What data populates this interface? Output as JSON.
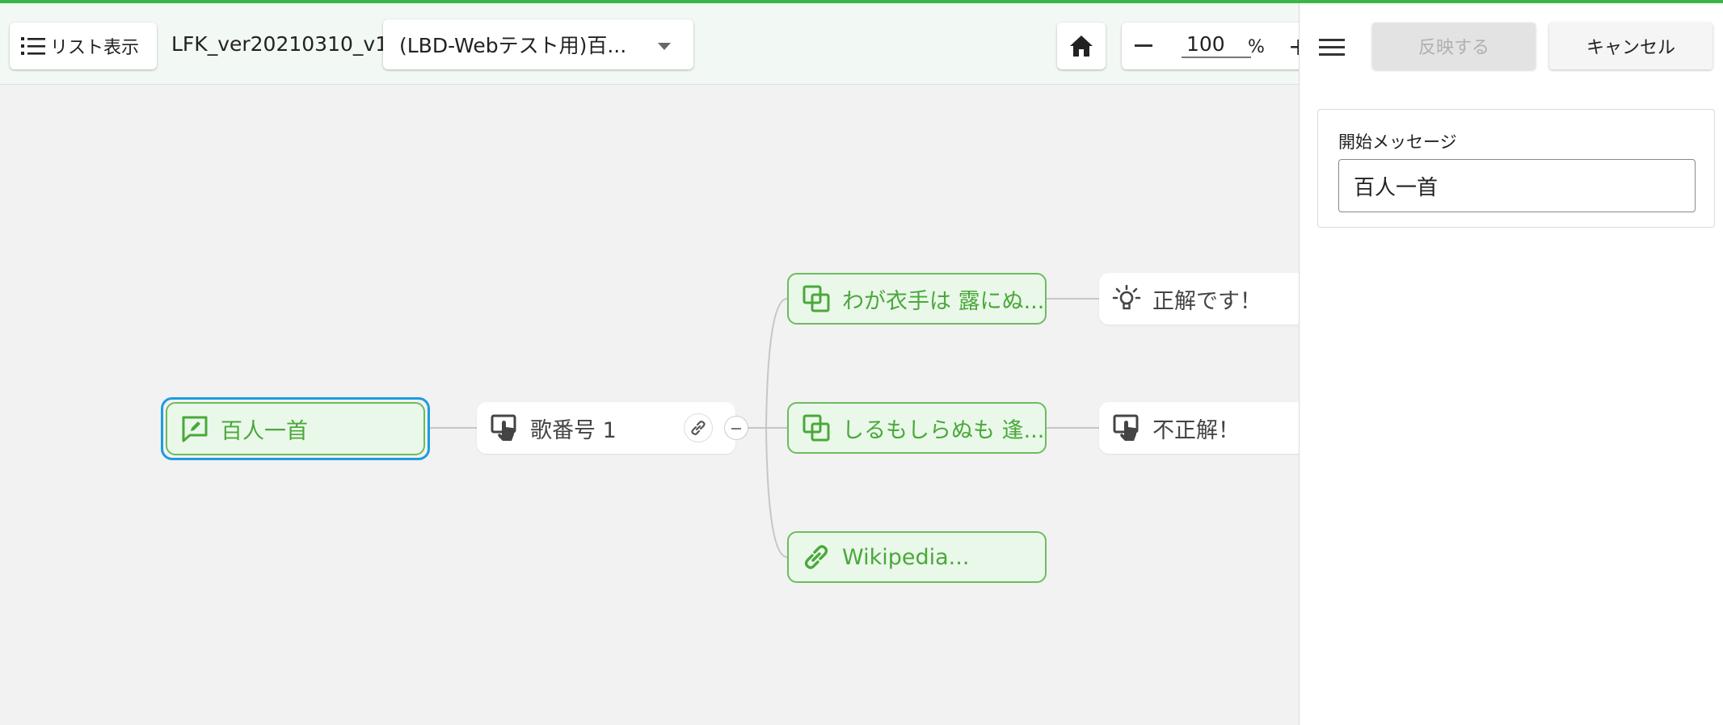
{
  "toolbar": {
    "list_view_label": "リスト表示",
    "file_name": "LFK_ver20210310_v1",
    "scenario_select": "(LBD-Webテスト用)百...",
    "zoom_value": "100",
    "zoom_unit": "%",
    "zoom_plus": "+"
  },
  "flow": {
    "start_node": "百人一首",
    "question_node": "歌番号 1",
    "options": [
      {
        "label": "わが衣手は 露にぬ...",
        "result": "正解です！"
      },
      {
        "label": "しるもしらぬも 逢...",
        "result": "不正解！"
      },
      {
        "label": "Wikipedia..."
      }
    ]
  },
  "panel": {
    "apply_label": "反映する",
    "cancel_label": "キャンセル",
    "field_label": "開始メッセージ",
    "field_value": "百人一首"
  },
  "colors": {
    "accent": "#3ab54a",
    "node_green": "#4aa83a",
    "selection": "#1e9be0"
  }
}
